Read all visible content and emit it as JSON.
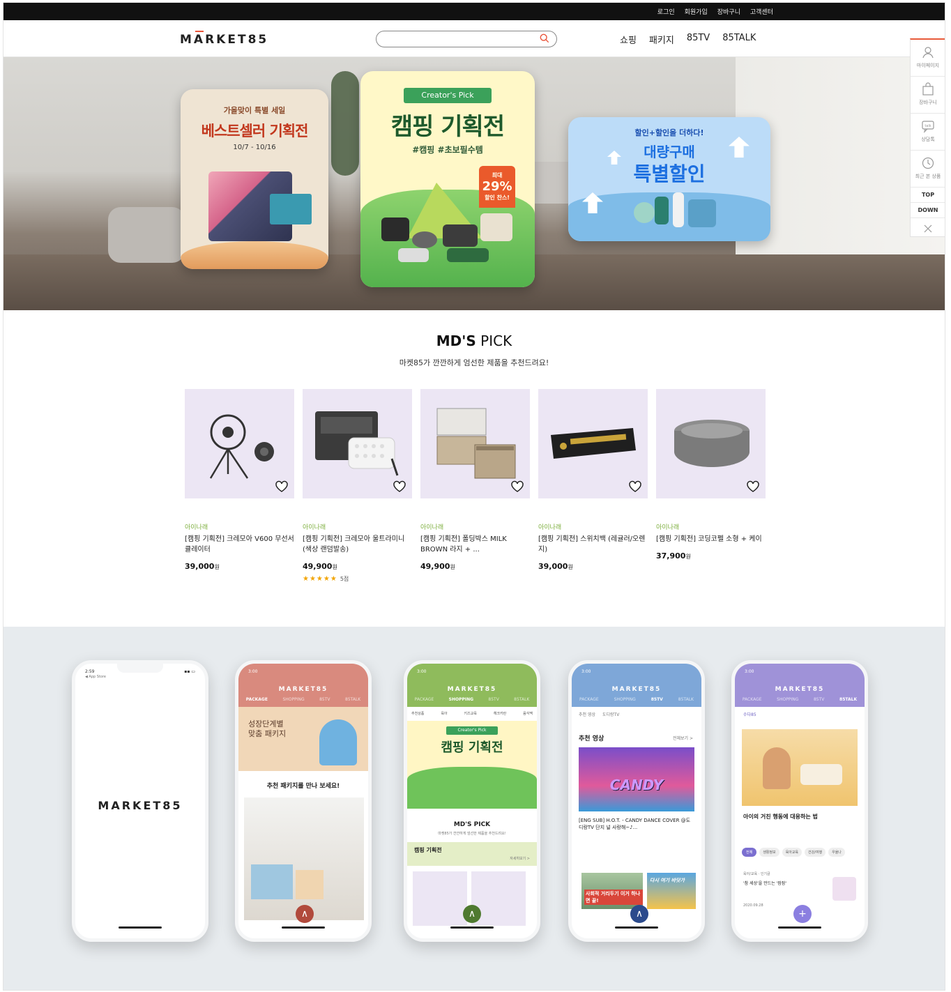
{
  "topbar": {
    "links": [
      "로그인",
      "회원가입",
      "장바구니",
      "고객센터"
    ]
  },
  "header": {
    "logo": "MARKET85",
    "search_placeholder": "",
    "nav": [
      "쇼핑",
      "패키지",
      "85TV",
      "85TALK"
    ]
  },
  "hero": {
    "card1": {
      "top": "가을맞이 특별 세일",
      "title": "베스트셀러 기획전",
      "date": "10/7 - 10/16"
    },
    "card2": {
      "ribbon": "Creator's Pick",
      "title": "캠핑 기획전",
      "tags": "#캠핑 #초보필수템",
      "badge_small": "최대",
      "badge_value": "29%",
      "badge_note": "할인 찬스!"
    },
    "card3": {
      "top": "할인+할인을 더하다!",
      "title1": "대량구매",
      "title2": "특별할인"
    }
  },
  "quick_menu": {
    "items": [
      {
        "label": "마이페이지",
        "icon": "user-icon"
      },
      {
        "label": "장바구니",
        "icon": "bag-icon"
      },
      {
        "label": "상담톡",
        "icon": "talk-icon"
      },
      {
        "label": "최근 본 상품",
        "icon": "clock-icon"
      }
    ],
    "top": "TOP",
    "down": "DOWN"
  },
  "md_pick": {
    "title_bold": "MD'S",
    "title_light": "PICK",
    "subtitle": "마켓85가 깐깐하게 엄선한 제품을 추천드려요!",
    "products": [
      {
        "brand": "아이나래",
        "name": "[캠핑 기획전] 크레모아 V600 무선서큘레이터",
        "price": "39,000",
        "unit": "원",
        "stars": "",
        "review": ""
      },
      {
        "brand": "아이나래",
        "name": "[캠핑 기획전] 크레모아 울트라미니 (색상 랜덤발송)",
        "price": "49,900",
        "unit": "원",
        "stars": "★★★★★",
        "review": "5점"
      },
      {
        "brand": "아이나래",
        "name": "[캠핑 기획전] 폴딩박스 MILK BROWN 라지 + ...",
        "price": "49,900",
        "unit": "원",
        "stars": "",
        "review": ""
      },
      {
        "brand": "아이나래",
        "name": "[캠핑 기획전] 스위치백 (레귤러/오렌지)",
        "price": "39,000",
        "unit": "원",
        "stars": "",
        "review": ""
      },
      {
        "brand": "아이나래",
        "name": "[캠핑 기획전] 코딩코펠 소형 + 케이스",
        "price": "37,900",
        "unit": "원",
        "stars": "",
        "review": ""
      }
    ]
  },
  "apps": {
    "splash": {
      "time": "2:59",
      "carrier": "◀ App Store",
      "logo": "MARKET85"
    },
    "package": {
      "time": "3:00",
      "logo": "MARKET85",
      "tabs": [
        "PACKAGE",
        "SHOPPING",
        "85TV",
        "85TALK"
      ],
      "banner1": "성장단계별",
      "banner2": "맞춤 패키지",
      "cta": "추천 패키지를 만나 보세요!"
    },
    "shopping": {
      "time": "3:00",
      "logo": "MARKET85",
      "tabs": [
        "PACKAGE",
        "SHOPPING",
        "85TV",
        "85TALK"
      ],
      "cats": [
        "추천상품",
        "육아",
        "키즈교육",
        "헤크카란",
        "음식맥"
      ],
      "ribbon": "Creator's Pick",
      "title": "캠핑 기획전",
      "md": "MD'S PICK",
      "md_sub": "마켓85가 깐깐하게 엄선한 제품을 추천드려요!",
      "section": "캠핑 기획전",
      "more": "자세히보기 >"
    },
    "tv": {
      "time": "3:00",
      "logo": "MARKET85",
      "tabs": [
        "PACKAGE",
        "SHOPPING",
        "85TV",
        "85TALK"
      ],
      "sub": [
        "추천 영상",
        "도디랑TV"
      ],
      "heading": "추천 영상",
      "more": "전체보기 >",
      "thumb": "CANDY",
      "caption": "[ENG SUB] H.O.T. - CANDY DANCE COVER @도디랑TV 단지 널 사랑해~♪...",
      "thumb2": "사회적 거리두기 이거 하나면 끝!",
      "thumb3": "다시 여기 바닷가"
    },
    "talk": {
      "time": "3:00",
      "logo": "MARKET85",
      "tabs": [
        "PACKAGE",
        "SHOPPING",
        "85TV",
        "85TALK"
      ],
      "sub": "수다85",
      "caption": "아이의 거친 행동에 대응하는 법",
      "chips": [
        "전체",
        "생활정보",
        "육아교육",
        "건강/여행",
        "우울나"
      ],
      "post_cat": "육아/교육 · 인기글",
      "post_title": "'참 세상'을 만드는 '잠잠'",
      "post_date": "2020.09.28"
    }
  },
  "colors": {
    "accent": "#e8543a",
    "package": "#d98a7e",
    "shopping": "#8fbb5c",
    "tv": "#7ea7d8",
    "talk": "#9f92d8"
  }
}
